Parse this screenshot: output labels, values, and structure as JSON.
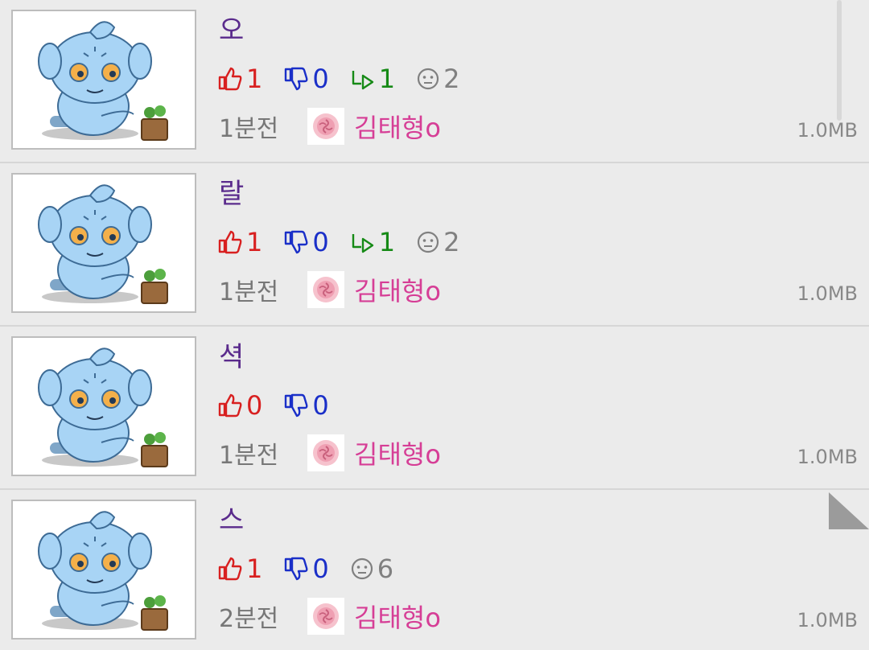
{
  "posts": [
    {
      "title": "오",
      "likes": "1",
      "dislikes": "0",
      "replies": "1",
      "comments": "2",
      "time": "1분전",
      "author": "김태형o",
      "size": "1.0MB"
    },
    {
      "title": "랄",
      "likes": "1",
      "dislikes": "0",
      "replies": "1",
      "comments": "2",
      "time": "1분전",
      "author": "김태형o",
      "size": "1.0MB"
    },
    {
      "title": "셕",
      "likes": "0",
      "dislikes": "0",
      "time": "1분전",
      "author": "김태형o",
      "size": "1.0MB"
    },
    {
      "title": "스",
      "likes": "1",
      "dislikes": "0",
      "comments": "6",
      "time": "2분전",
      "author": "김태형o",
      "size": "1.0MB"
    }
  ],
  "icons": {
    "like": "thumbs-up-icon",
    "dislike": "thumbs-down-icon",
    "reply": "reply-arrow-icon",
    "comment": "smiley-icon",
    "avatar": "rose-icon",
    "thumbnail": "blue-tiger-cartoon"
  },
  "colors": {
    "title": "#5a2b8c",
    "like": "#d82020",
    "dislike": "#1a2fc8",
    "reply": "#168a16",
    "comment": "#808080",
    "author": "#d63e96",
    "background": "#ebebeb"
  }
}
